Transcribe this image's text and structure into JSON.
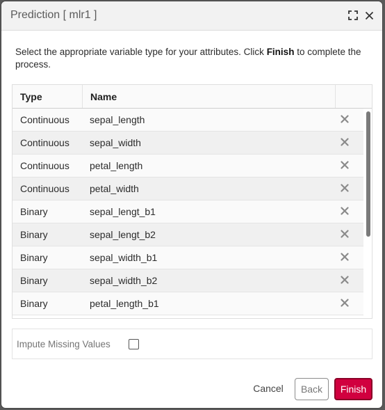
{
  "dialog": {
    "title": "Prediction [ mlr1 ]",
    "maximize_icon": "maximize-icon",
    "close_icon": "close-icon"
  },
  "description": {
    "before": "Select the appropriate variable type for your attributes. Click ",
    "bold": "Finish",
    "after": " to complete the process."
  },
  "table": {
    "headers": {
      "type": "Type",
      "name": "Name"
    },
    "rows": [
      {
        "type": "Continuous",
        "name": "sepal_length"
      },
      {
        "type": "Continuous",
        "name": "sepal_width"
      },
      {
        "type": "Continuous",
        "name": "petal_length"
      },
      {
        "type": "Continuous",
        "name": "petal_width"
      },
      {
        "type": "Binary",
        "name": "sepal_lengt_b1"
      },
      {
        "type": "Binary",
        "name": "sepal_lengt_b2"
      },
      {
        "type": "Binary",
        "name": "sepal_width_b1"
      },
      {
        "type": "Binary",
        "name": "sepal_width_b2"
      },
      {
        "type": "Binary",
        "name": "petal_length_b1"
      }
    ],
    "remove_icon": "remove-icon"
  },
  "impute": {
    "label": "Impute Missing Values",
    "checked": false
  },
  "footer": {
    "cancel_label": "Cancel",
    "back_label": "Back",
    "finish_label": "Finish"
  },
  "colors": {
    "accent": "#d1003f",
    "accent_border": "#8a0027"
  }
}
